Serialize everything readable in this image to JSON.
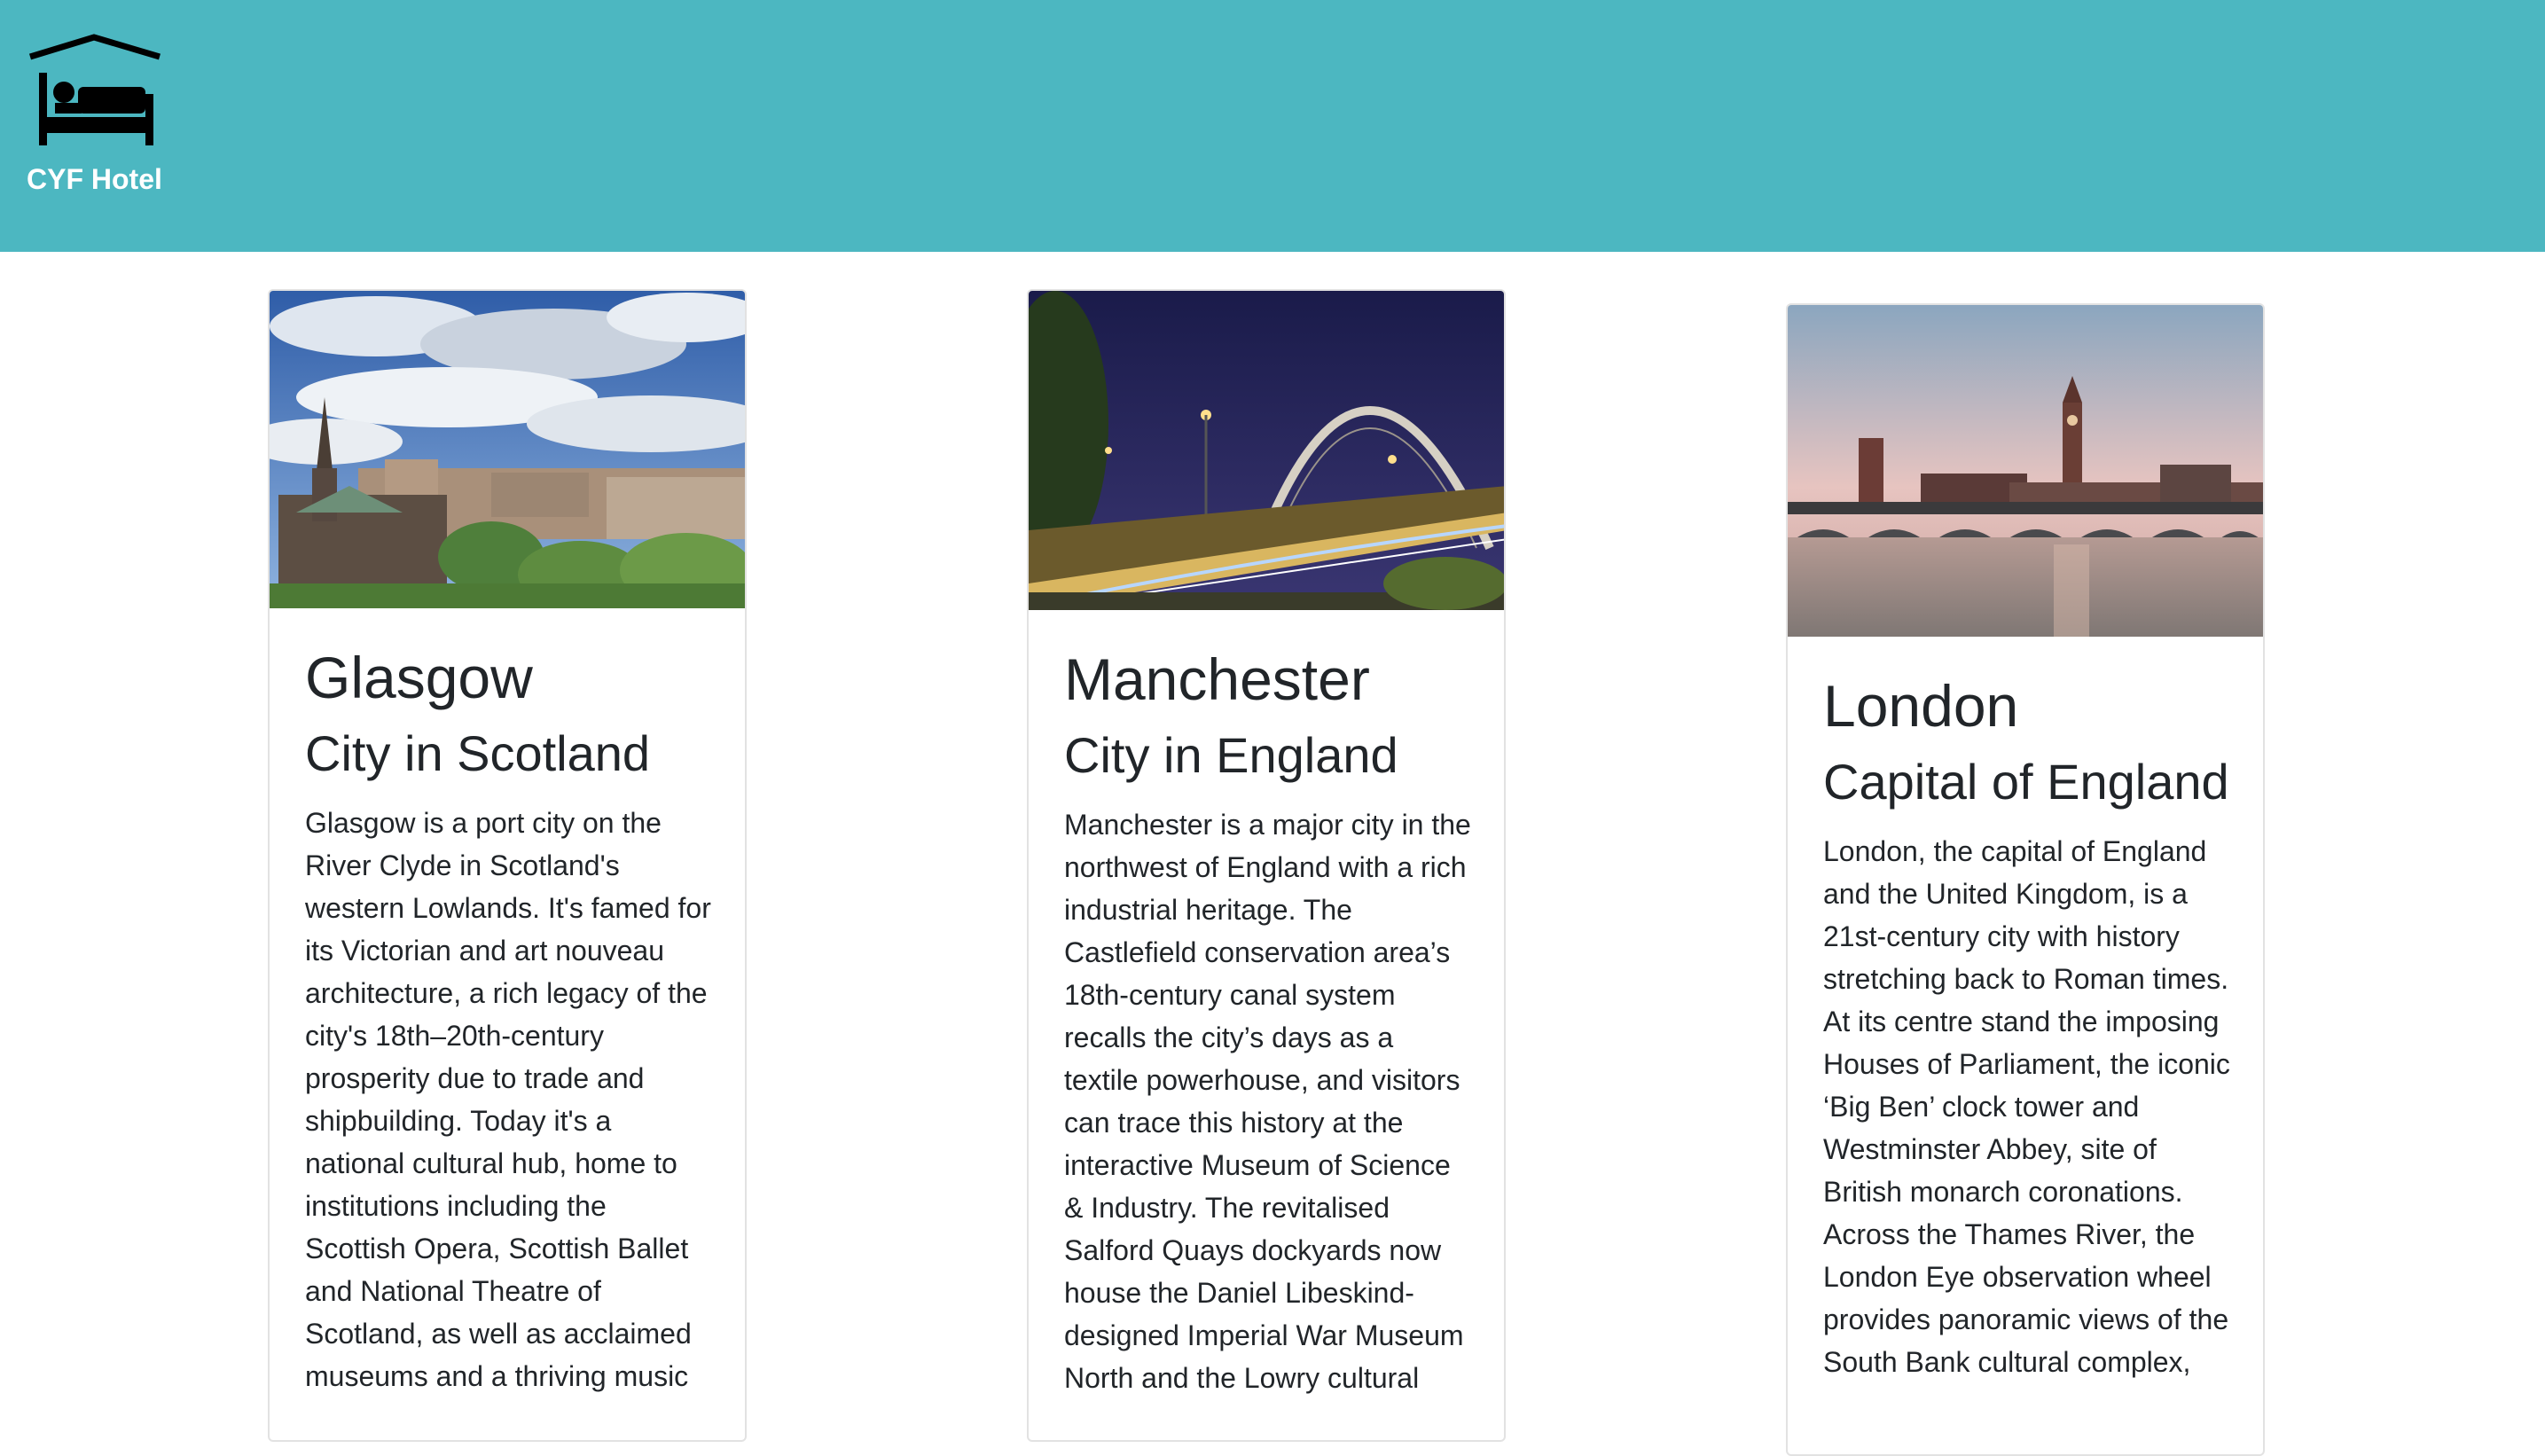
{
  "header": {
    "brand": "CYF Hotel",
    "logo_icon": "hotel-bed-icon",
    "background_color": "#4cb7c1"
  },
  "cards": [
    {
      "image_icon": "glasgow-cathedral-photo",
      "title": "Glasgow",
      "subtitle": "City in Scotland",
      "text": "Glasgow is a port city on the River Clyde in Scotland's western Lowlands. It's famed for its Victorian and art nouveau architecture, a rich legacy of the city's 18th–20th-century prosperity due to trade and shipbuilding. Today it's a national cultural hub, home to institutions including the Scottish Opera, Scottish Ballet and National Theatre of Scotland, as well as acclaimed museums and a thriving music"
    },
    {
      "image_icon": "manchester-bridge-photo",
      "title": "Manchester",
      "subtitle": "City in England",
      "text": "Manchester is a major city in the northwest of England with a rich industrial heritage. The Castlefield conservation area’s 18th-century canal system recalls the city’s days as a textile powerhouse, and visitors can trace this history at the interactive Museum of Science & Industry. The revitalised Salford Quays dockyards now house the Daniel Libeskind-designed Imperial War Museum North and the Lowry cultural"
    },
    {
      "image_icon": "london-westminster-photo",
      "title": "London",
      "subtitle": "Capital of England",
      "text": "London, the capital of England and the United Kingdom, is a 21st-century city with history stretching back to Roman times. At its centre stand the imposing Houses of Parliament, the iconic ‘Big Ben’ clock tower and Westminster Abbey, site of British monarch coronations. Across the Thames River, the London Eye observation wheel provides panoramic views of the South Bank cultural complex,"
    }
  ]
}
